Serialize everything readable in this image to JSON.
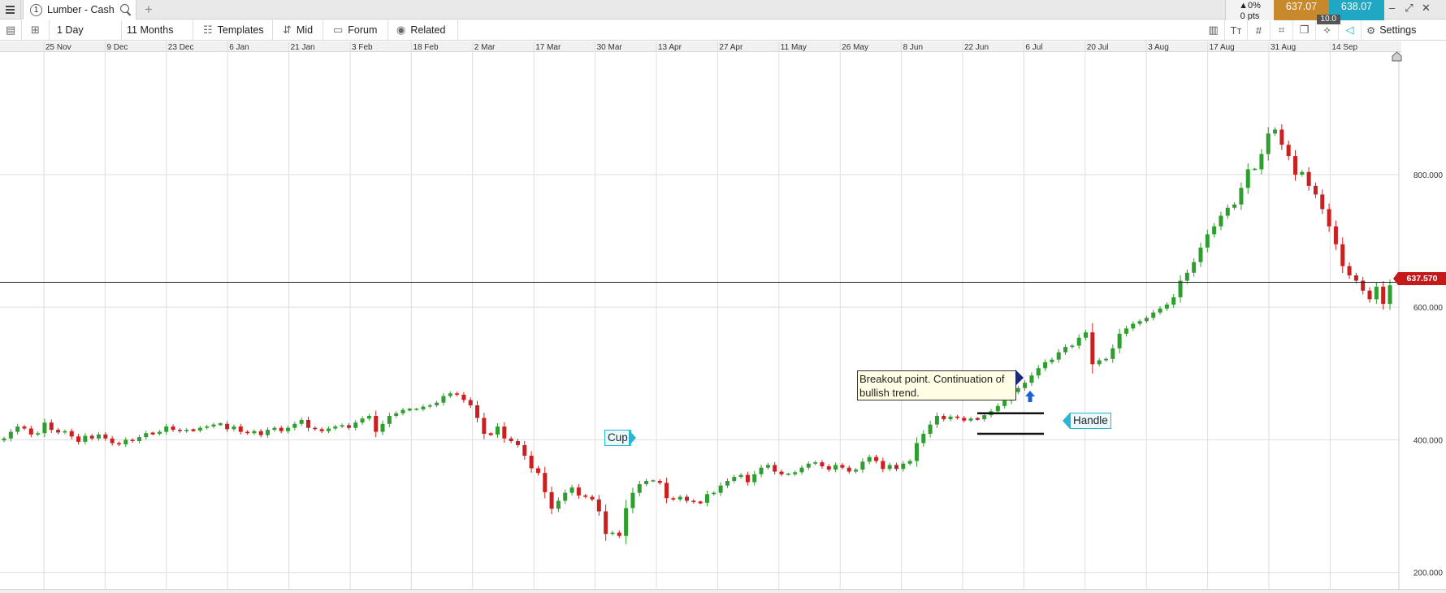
{
  "app": {
    "tab_number": "1",
    "tab_title": "Lumber - Cash",
    "add_tab": "+"
  },
  "price_panel": {
    "change_pct": "▲0%",
    "change_pts": "0 pts",
    "sell": "637.07",
    "buy": "638.07",
    "spread": "10.0"
  },
  "toolbar": {
    "interval": "1 Day",
    "range": "11 Months",
    "templates": "Templates",
    "price_type": "Mid",
    "forum": "Forum",
    "related": "Related",
    "settings": "Settings"
  },
  "annotations": {
    "breakout": "Breakout point. Continuation of bullish trend.",
    "cup": "Cup",
    "handle": "Handle"
  },
  "current_price_tag": "637.570",
  "colors": {
    "up": "#2e9e2e",
    "down": "#cc1f1f",
    "accent_sell": "#c8882c",
    "accent_buy": "#20a7c4",
    "grid": "#dedede"
  },
  "chart_data": {
    "type": "candlestick",
    "title": "",
    "x_tick_labels": [
      "25 Nov",
      "9 Dec",
      "23 Dec",
      "6 Jan",
      "21 Jan",
      "3 Feb",
      "18 Feb",
      "2 Mar",
      "17 Mar",
      "30 Mar",
      "13 Apr",
      "27 Apr",
      "11 May",
      "26 May",
      "8 Jun",
      "22 Jun",
      "6 Jul",
      "20 Jul",
      "3 Aug",
      "17 Aug",
      "31 Aug",
      "14 Sep"
    ],
    "y_tick_labels": [
      "200.000",
      "400.000",
      "600.000",
      "800.000"
    ],
    "y_ticks": [
      200,
      400,
      600,
      800
    ],
    "ylim": [
      175,
      985
    ],
    "current_price": 637.57,
    "grid": true,
    "ohlc_close": [
      402,
      412,
      420,
      417,
      408,
      410,
      426,
      415,
      411,
      413,
      405,
      397,
      406,
      402,
      408,
      402,
      395,
      393,
      400,
      398,
      404,
      410,
      409,
      412,
      420,
      415,
      413,
      415,
      414,
      418,
      420,
      423,
      424,
      416,
      420,
      412,
      410,
      413,
      407,
      415,
      418,
      413,
      418,
      424,
      430,
      418,
      416,
      413,
      417,
      420,
      422,
      418,
      426,
      432,
      436,
      412,
      424,
      436,
      440,
      445,
      446,
      446,
      450,
      452,
      456,
      466,
      470,
      468,
      460,
      452,
      433,
      409,
      408,
      420,
      402,
      398,
      392,
      376,
      357,
      350,
      321,
      296,
      308,
      320,
      328,
      316,
      314,
      310,
      292,
      258,
      260,
      255,
      297,
      320,
      333,
      338,
      338,
      335,
      312,
      310,
      314,
      308,
      306,
      305,
      318,
      320,
      331,
      338,
      344,
      347,
      336,
      348,
      358,
      362,
      352,
      348,
      348,
      351,
      358,
      364,
      366,
      360,
      355,
      362,
      358,
      352,
      355,
      367,
      374,
      368,
      356,
      362,
      356,
      364,
      368,
      395,
      409,
      423,
      436,
      431,
      435,
      433,
      429,
      432,
      431,
      437,
      443,
      451,
      459,
      472,
      478,
      486,
      497,
      508,
      517,
      521,
      532,
      540,
      542,
      554,
      562,
      514,
      520,
      522,
      538,
      560,
      568,
      575,
      579,
      584,
      592,
      598,
      604,
      615,
      640,
      652,
      668,
      690,
      710,
      722,
      738,
      750,
      755,
      780,
      808,
      808,
      831,
      862,
      868,
      845,
      828,
      800,
      804,
      783,
      770,
      748,
      722,
      695,
      662,
      648,
      640,
      625,
      612,
      631,
      605,
      633
    ],
    "note": "closes approximated from chart"
  }
}
